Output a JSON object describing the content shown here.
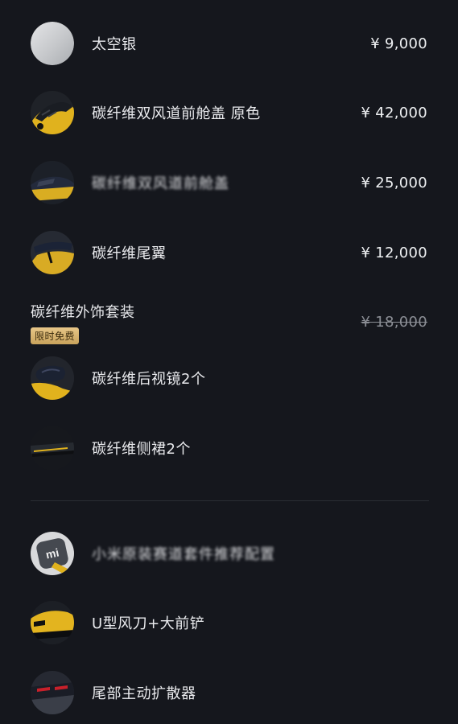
{
  "items": [
    {
      "label": "太空银",
      "price": "¥ 9,000",
      "icon": "silver-swatch-icon"
    },
    {
      "label": "碳纤维双风道前舱盖 原色",
      "price": "¥ 42,000",
      "icon": "front-hood-icon"
    },
    {
      "label": "碳纤维双风道前舱盖",
      "price": "¥ 25,000",
      "icon": "car-side-icon",
      "blurred": true
    },
    {
      "label": "碳纤维尾翼",
      "price": "¥ 12,000",
      "icon": "rear-wing-icon"
    }
  ],
  "package": {
    "title": "碳纤维外饰套装",
    "badge": "限时免费",
    "price": "¥ 18,000",
    "items": [
      {
        "label": "碳纤维后视镜2个",
        "icon": "mirror-icon"
      },
      {
        "label": "碳纤维侧裙2个",
        "icon": "side-skirt-icon"
      }
    ]
  },
  "extras": [
    {
      "label": "小米原装赛道套件推荐配置",
      "icon": "mi-logo-icon",
      "blurred": true
    },
    {
      "label": "U型风刀+大前铲",
      "icon": "front-splitter-icon"
    },
    {
      "label": "尾部主动扩散器",
      "icon": "rear-diffuser-icon"
    }
  ],
  "colors": {
    "background": "#15171d",
    "text": "#e9eaed",
    "strike": "#8b8e95",
    "badge_gold": "#d8b572",
    "divider": "#2a2d34"
  }
}
